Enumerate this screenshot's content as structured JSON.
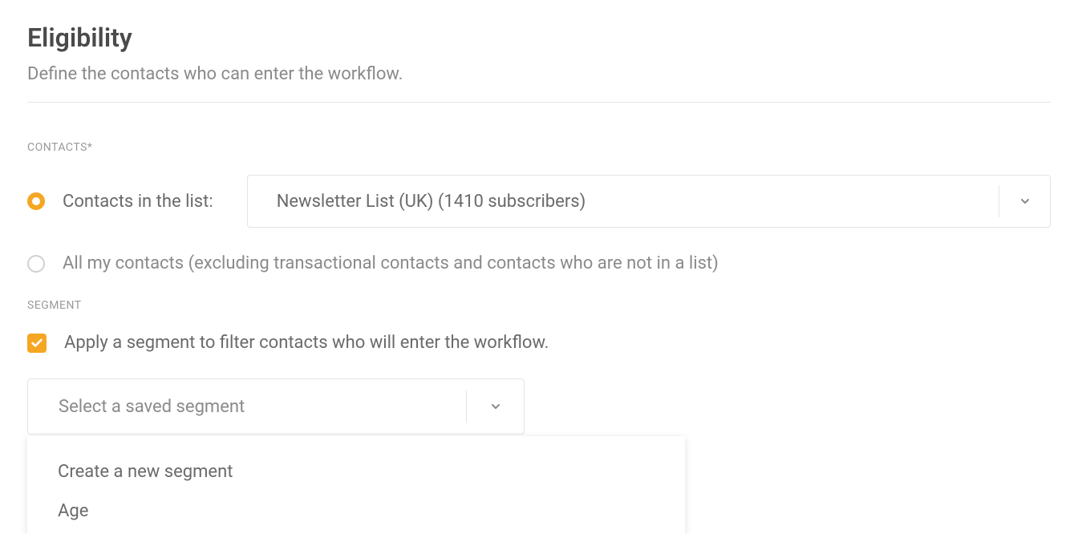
{
  "header": {
    "title": "Eligibility",
    "subtitle": "Define the contacts who can enter the workflow."
  },
  "contacts": {
    "section_label": "CONTACTS*",
    "option_in_list": "Contacts in the list:",
    "list_dropdown_value": "Newsletter List (UK) (1410 subscribers)",
    "option_all": "All my contacts (excluding transactional contacts and contacts who are not in a list)"
  },
  "segment": {
    "section_label": "SEGMENT",
    "checkbox_label": "Apply a segment to filter contacts who will enter the workflow.",
    "dropdown_placeholder": "Select a saved segment",
    "options": [
      "Create a new segment",
      "Age"
    ]
  }
}
